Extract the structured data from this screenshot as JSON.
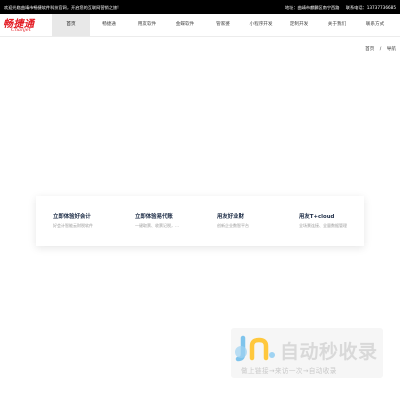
{
  "topbar": {
    "welcome": "欢迎光临曲靖市畅捷软件科技官网，开启您的互联网营销之旅!",
    "address": "地址：曲靖市麒麟区南宁西路",
    "phone": "联系电话：13737736685"
  },
  "logo": {
    "cn": "畅捷通",
    "en": "Chanjet",
    "color": "#e31b23"
  },
  "nav": {
    "items": [
      {
        "label": "首页",
        "active": true
      },
      {
        "label": "畅捷通"
      },
      {
        "label": "用友软件"
      },
      {
        "label": "金蝶软件"
      },
      {
        "label": "管家婆"
      },
      {
        "label": "小程序开发"
      },
      {
        "label": "定制开发"
      },
      {
        "label": "关于我们"
      },
      {
        "label": "联系方式"
      }
    ]
  },
  "breadcrumb": {
    "home": "首页",
    "separator": "/",
    "current": "导航"
  },
  "cards": [
    {
      "title": "立即体验好会计",
      "desc": "好会计智能云财税软件"
    },
    {
      "title": "立即体验易代账",
      "desc": "一键取票、收票记税，…"
    },
    {
      "title": "用友好业财",
      "desc": "创新企业数智平台"
    },
    {
      "title": "用友T+cloud",
      "desc": "全场景连接、全量数据管理"
    }
  ],
  "watermark": {
    "title": "自动秒收录",
    "subtitle": "做上链接→来访一次→自动收录"
  }
}
